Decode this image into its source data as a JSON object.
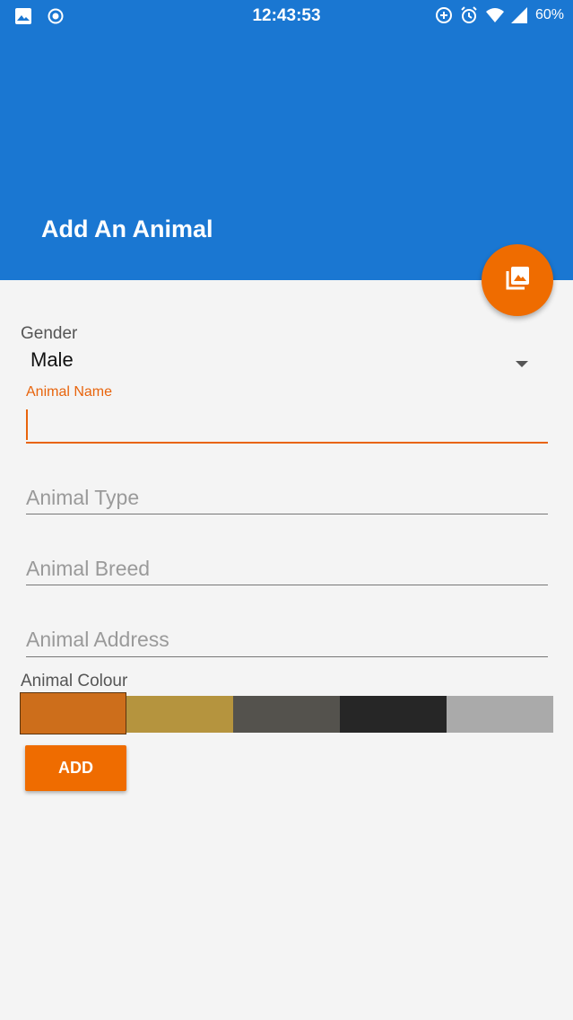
{
  "status_bar": {
    "time": "12:43:53",
    "battery": "60%",
    "left_icons": [
      "image-icon",
      "record-icon"
    ],
    "right_icons": [
      "data-saver-icon",
      "alarm-icon",
      "wifi-icon",
      "signal-icon"
    ]
  },
  "app_bar": {
    "title": "Add An Animal",
    "color": "#1a77d2"
  },
  "fab": {
    "icon": "photo-library-icon",
    "color": "#ef6c00"
  },
  "form": {
    "gender": {
      "label": "Gender",
      "value": "Male"
    },
    "animal_name": {
      "label": "Animal Name",
      "value": ""
    },
    "animal_type": {
      "placeholder": "Animal Type"
    },
    "animal_breed": {
      "placeholder": "Animal Breed"
    },
    "animal_address": {
      "placeholder": "Animal Address"
    },
    "colour": {
      "label": "Animal Colour",
      "swatches": [
        "#cd6e1b",
        "#b5943e",
        "#54524d",
        "#262626",
        "#aaaaaa"
      ],
      "selected_index": 0
    },
    "add_label": "ADD"
  },
  "accent_color": "#e8640c"
}
